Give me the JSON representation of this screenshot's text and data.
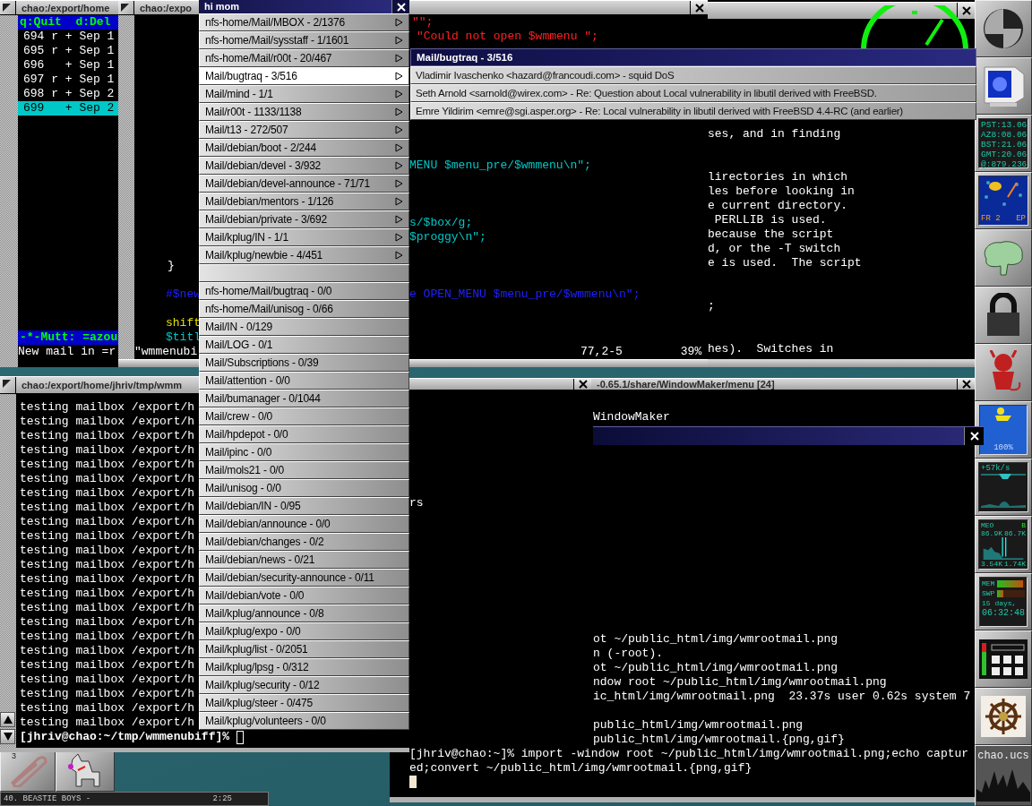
{
  "mutt": {
    "title": "chao:/export/home",
    "help": "q:Quit  d:Del",
    "messages": [
      {
        "text": "694 r + Sep 1",
        "selected": false
      },
      {
        "text": "695 r + Sep 1",
        "selected": false
      },
      {
        "text": "696   + Sep 1",
        "selected": false
      },
      {
        "text": "697 r + Sep 1",
        "selected": false
      },
      {
        "text": "698 r + Sep 2",
        "selected": false
      },
      {
        "text": "699   + Sep 2",
        "selected": true
      }
    ],
    "status": "-*-Mutt: =azou",
    "message_line": "New mail in =r"
  },
  "vim": {
    "title": "chao:/expo",
    "left_lines": [
      {
        "text": "}"
      },
      {
        "text": "#$new",
        "color": "#2020ff"
      },
      {
        "text": "shift",
        "color": "#e0e000"
      },
      {
        "text": "$titl",
        "color": "#00c8c8"
      },
      {
        "text": "\"wmmenubi"
      }
    ],
    "right_lines": [
      {
        "text": "\"\";",
        "color": "#ff2020"
      },
      {
        "text": "\"Could not open $wmmenu \";",
        "color": "#ff2020"
      },
      {
        "text": "MENU $menu_pre/$wmmenu\\n\";",
        "color": "#00c8c8"
      },
      {
        "text": "s/$box/g;",
        "color": "#00c8c8"
      },
      {
        "text": "$proggy\\n\";",
        "color": "#00c8c8"
      },
      {
        "text": "e OPEN_MENU $menu_pre/$wmmenu\\n\";",
        "color": "#2020ff"
      }
    ],
    "ruler": "77,2-5",
    "percent": "39%"
  },
  "perldoc": {
    "lines": [
      "ses, and in finding",
      "lirectories in which",
      "les before looking in",
      "e current directory.",
      " PERLLIB is used.",
      "because the script",
      "d, or the -T switch",
      "e is used.  The script",
      ";",
      "hes).  Switches in"
    ]
  },
  "menu": {
    "title": "hi mom",
    "items": [
      {
        "label": "nfs-home/Mail/MBOX - 2/1376",
        "kind": "submenu",
        "selected": false
      },
      {
        "label": "nfs-home/Mail/sysstaff - 1/1601",
        "kind": "submenu",
        "selected": false
      },
      {
        "label": "nfs-home/Mail/r00t - 20/467",
        "kind": "submenu",
        "selected": false
      },
      {
        "label": "Mail/bugtraq - 3/516",
        "kind": "submenu",
        "selected": true
      },
      {
        "label": "Mail/mind - 1/1",
        "kind": "submenu",
        "selected": false
      },
      {
        "label": "Mail/r00t - 1133/1138",
        "kind": "submenu",
        "selected": false
      },
      {
        "label": "Mail/t13 - 272/507",
        "kind": "submenu",
        "selected": false
      },
      {
        "label": "Mail/debian/boot - 2/244",
        "kind": "submenu",
        "selected": false
      },
      {
        "label": "Mail/debian/devel - 3/932",
        "kind": "submenu",
        "selected": false
      },
      {
        "label": "Mail/debian/devel-announce - 71/71",
        "kind": "submenu",
        "selected": false
      },
      {
        "label": "Mail/debian/mentors - 1/126",
        "kind": "submenu",
        "selected": false
      },
      {
        "label": "Mail/debian/private - 3/692",
        "kind": "submenu",
        "selected": false
      },
      {
        "label": "Mail/kplug/IN - 1/1",
        "kind": "submenu",
        "selected": false
      },
      {
        "label": "Mail/kplug/newbie - 4/451",
        "kind": "submenu",
        "selected": false
      },
      {
        "kind": "blank",
        "selected": false
      },
      {
        "label": "nfs-home/Mail/bugtraq - 0/0",
        "kind": "item",
        "selected": false
      },
      {
        "label": "nfs-home/Mail/unisog - 0/66",
        "kind": "item",
        "selected": false
      },
      {
        "label": "Mail/IN - 0/129",
        "kind": "item",
        "selected": false
      },
      {
        "label": "Mail/LOG - 0/1",
        "kind": "item",
        "selected": false
      },
      {
        "label": "Mail/Subscriptions - 0/39",
        "kind": "item",
        "selected": false
      },
      {
        "label": "Mail/attention - 0/0",
        "kind": "item",
        "selected": false
      },
      {
        "label": "Mail/bumanager - 0/1044",
        "kind": "item",
        "selected": false
      },
      {
        "label": "Mail/crew - 0/0",
        "kind": "item",
        "selected": false
      },
      {
        "label": "Mail/hpdepot - 0/0",
        "kind": "item",
        "selected": false
      },
      {
        "label": "Mail/ipinc - 0/0",
        "kind": "item",
        "selected": false
      },
      {
        "label": "Mail/mols21 - 0/0",
        "kind": "item",
        "selected": false
      },
      {
        "label": "Mail/unisog - 0/0",
        "kind": "item",
        "selected": false
      },
      {
        "label": "Mail/debian/IN - 0/95",
        "kind": "item",
        "selected": false
      },
      {
        "label": "Mail/debian/announce - 0/0",
        "kind": "item",
        "selected": false
      },
      {
        "label": "Mail/debian/changes - 0/2",
        "kind": "item",
        "selected": false
      },
      {
        "label": "Mail/debian/news - 0/21",
        "kind": "item",
        "selected": false
      },
      {
        "label": "Mail/debian/security-announce - 0/11",
        "kind": "item",
        "selected": false
      },
      {
        "label": "Mail/debian/vote - 0/0",
        "kind": "item",
        "selected": false
      },
      {
        "label": "Mail/kplug/announce - 0/8",
        "kind": "item",
        "selected": false
      },
      {
        "label": "Mail/kplug/expo - 0/0",
        "kind": "item",
        "selected": false
      },
      {
        "label": "Mail/kplug/list - 0/2051",
        "kind": "item",
        "selected": false
      },
      {
        "label": "Mail/kplug/lpsg - 0/312",
        "kind": "item",
        "selected": false
      },
      {
        "label": "Mail/kplug/security - 0/12",
        "kind": "item",
        "selected": false
      },
      {
        "label": "Mail/kplug/steer - 0/475",
        "kind": "item",
        "selected": false
      },
      {
        "label": "Mail/kplug/volunteers - 0/0",
        "kind": "item",
        "selected": false
      }
    ]
  },
  "submenu": {
    "title": "Mail/bugtraq - 3/516",
    "items": [
      "Vladimir Ivaschenko <hazard@francoudi.com> - squid DoS",
      "Seth Arnold <sarnold@wirex.com> - Re: Question about Local vulnerability in libutil derived with FreeBSD.",
      "Emre Yildirim <emre@sgi.asper.org> - Re: Local vulnerability in libutil derived with FreeBSD 4.4-RC (and earlier)"
    ]
  },
  "terminal": {
    "title": "chao:/export/home/jhriv/tmp/wmm",
    "lines": [
      "testing mailbox /export/h",
      "testing mailbox /export/h",
      "testing mailbox /export/h",
      "testing mailbox /export/h",
      "testing mailbox /export/h",
      "testing mailbox /export/h",
      "testing mailbox /export/h",
      "testing mailbox /export/h",
      "testing mailbox /export/h",
      "testing mailbox /export/h",
      "testing mailbox /export/h",
      "testing mailbox /export/h",
      "testing mailbox /export/h",
      "testing mailbox /export/h",
      "testing mailbox /export/h",
      "testing mailbox /export/h",
      "testing mailbox /export/h",
      "testing mailbox /export/h",
      "testing mailbox /export/h",
      "testing mailbox /export/h",
      "testing mailbox /export/h",
      "testing mailbox /export/h",
      "testing mailbox /export/h"
    ],
    "prompt": "[jhriv@chao:~/tmp/wmmenubiff]%"
  },
  "editor_terminal": {
    "title": "-0.65.1/share/WindowMaker/menu  [24]",
    "lines": [
      "WindowMaker",
      "rs",
      "ot ~/public_html/img/wmrootmail.png",
      "n (-root).",
      "ot ~/public_html/img/wmrootmail.png",
      "ndow root ~/public_html/img/wmrootmail.png",
      "ic_html/img/wmrootmail.png  23.37s user 0.62s system 7",
      "public_html/img/wmrootmail.png",
      "public_html/img/wmrootmail.{png,gif}",
      "[jhriv@chao:~]% import -window root ~/public_html/img/wmrootmail.png;echo captur",
      "ed;convert ~/public_html/img/wmrootmail.{png,gif}"
    ]
  },
  "dock": {
    "clocks": [
      "PST:13.06",
      "AZ8:08.06",
      "BST:21.06",
      "GMT:20.06",
      "@:879.236"
    ],
    "calendar_day": "FR 2",
    "calendar_month": "EP",
    "battery": "100%",
    "net_rate": "+57k/s",
    "net_name": "MEO",
    "net_flag": "B",
    "net_in": "86.9K",
    "net_out": "86.7K",
    "net_avg_in": "3.54K",
    "net_avg_out": "1.74K",
    "meters": [
      {
        "label": "MEM",
        "level": 0.95
      },
      {
        "label": "SWP",
        "level": 0.2
      }
    ],
    "uptime_days": "15 days,",
    "uptime_clock": "06:32:48",
    "host": "chao.ucs"
  },
  "bottom_dock": {
    "clip_number": "3",
    "track": "40. BEASTIE BOYS -",
    "time": "2:25"
  }
}
